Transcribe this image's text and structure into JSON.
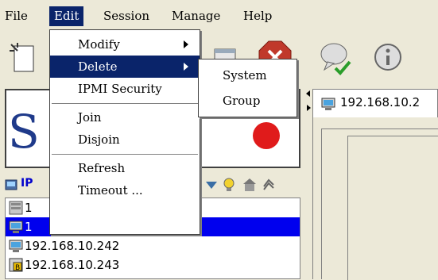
{
  "menubar": {
    "items": [
      "File",
      "Edit",
      "Session",
      "Manage",
      "Help"
    ]
  },
  "edit_menu": {
    "items": [
      {
        "label": "Modify"
      },
      {
        "label": "Delete"
      },
      {
        "label": "IPMI Security"
      },
      {
        "label": "Join"
      },
      {
        "label": "Disjoin"
      },
      {
        "label": "Refresh"
      },
      {
        "label": "Timeout ..."
      }
    ]
  },
  "delete_submenu": {
    "items": [
      "System",
      "Group"
    ]
  },
  "logo": {
    "text": "S          ICR",
    "dot_color": "#e01b1b",
    "text_color": "#1f3a8a"
  },
  "tree": {
    "header_label": "IP",
    "rows": [
      {
        "label": "1",
        "icon": "server-icon"
      },
      {
        "label": "1",
        "icon": "computer-icon",
        "selected": true
      },
      {
        "label": "192.168.10.242",
        "icon": "computer-icon"
      },
      {
        "label": "192.168.10.243",
        "icon": "ipmi-node-icon"
      }
    ]
  },
  "tab": {
    "label": "192.168.10.2"
  },
  "colors": {
    "menu_highlight": "#0a246a",
    "tree_selected": "#0000ee",
    "window_bg": "#ece9d8"
  }
}
